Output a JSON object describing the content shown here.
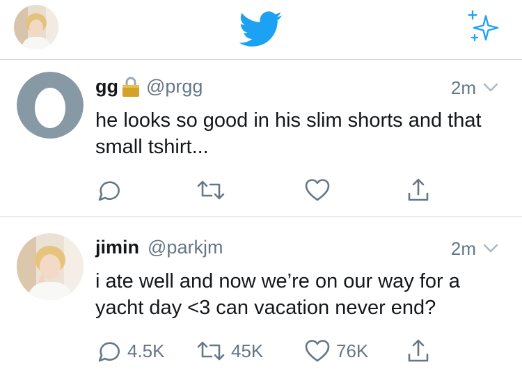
{
  "topbar": {
    "profile_avatar": "user-avatar-photo",
    "logo": "twitter-bird-icon",
    "compose": "sparkle-icon"
  },
  "colors": {
    "brand_blue": "#1da1f2",
    "text": "#14171a",
    "secondary_text": "#657786",
    "divider": "#cfd5da",
    "egg_avatar_bg": "#8899a6",
    "lock_gold": "#d3a22a"
  },
  "tweets": [
    {
      "name": "gg",
      "protected": true,
      "handle": "@prgg",
      "time": "2m",
      "text": "he looks so good in his slim shorts and that small tshirt...",
      "reply_count": "",
      "retweet_count": "",
      "like_count": ""
    },
    {
      "name": "jimin",
      "protected": false,
      "handle": "@parkjm",
      "time": "2m",
      "text": "i ate well and now we’re on our way for a yacht day <3 can vacation never end?",
      "reply_count": "4.5K",
      "retweet_count": "45K",
      "like_count": "76K"
    }
  ]
}
